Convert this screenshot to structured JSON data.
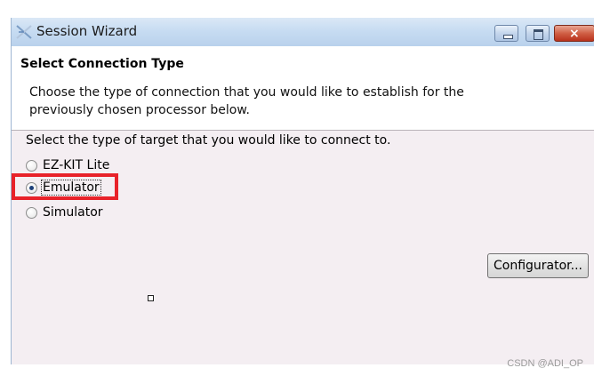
{
  "window": {
    "title": "Session Wizard",
    "icon": "session-wizard-icon",
    "controls": [
      "minimize-icon",
      "maximize-icon",
      "close-icon"
    ]
  },
  "header": {
    "title": "Select Connection Type",
    "description": "Choose the type of connection that you would like to establish for the previously chosen processor below."
  },
  "main": {
    "prompt": "Select the type of target that you would like to connect to.",
    "options": [
      {
        "label": "EZ-KIT Lite",
        "selected": false
      },
      {
        "label": "Emulator",
        "selected": true
      },
      {
        "label": "Simulator",
        "selected": false
      }
    ],
    "configurator_label": "Configurator..."
  },
  "annotation": {
    "highlight_color": "#e8222a"
  },
  "watermark": "CSDN @ADI_OP",
  "colors": {
    "titlebar": "#c7dcf2",
    "body": "#f4eef2",
    "close": "#c8452e"
  }
}
